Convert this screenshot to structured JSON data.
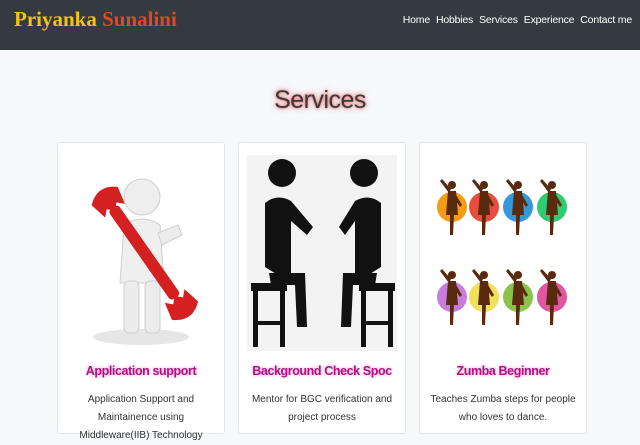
{
  "brand": {
    "first": "Priyanka",
    "last": "Sunalini"
  },
  "nav": {
    "items": [
      "Home",
      "Hobbies",
      "Services",
      "Experience",
      "Contact me"
    ]
  },
  "services": {
    "title": "Services",
    "cards": [
      {
        "title": "Application support",
        "desc": "Application Support and Maintainence using Middleware(IIB) Technology",
        "image": "person-with-wrench"
      },
      {
        "title": "Background Check Spoc",
        "desc": "Mentor for BGC verification and project process",
        "image": "two-people-talking"
      },
      {
        "title": "Zumba Beginner",
        "desc": "Teaches Zumba steps for people who loves to dance.",
        "image": "dancers-silhouettes"
      }
    ]
  },
  "colors": {
    "navbar": "#343a40",
    "brand_first": "#f1c40f",
    "brand_last": "#e8451e",
    "card_title": "#b3127e"
  }
}
